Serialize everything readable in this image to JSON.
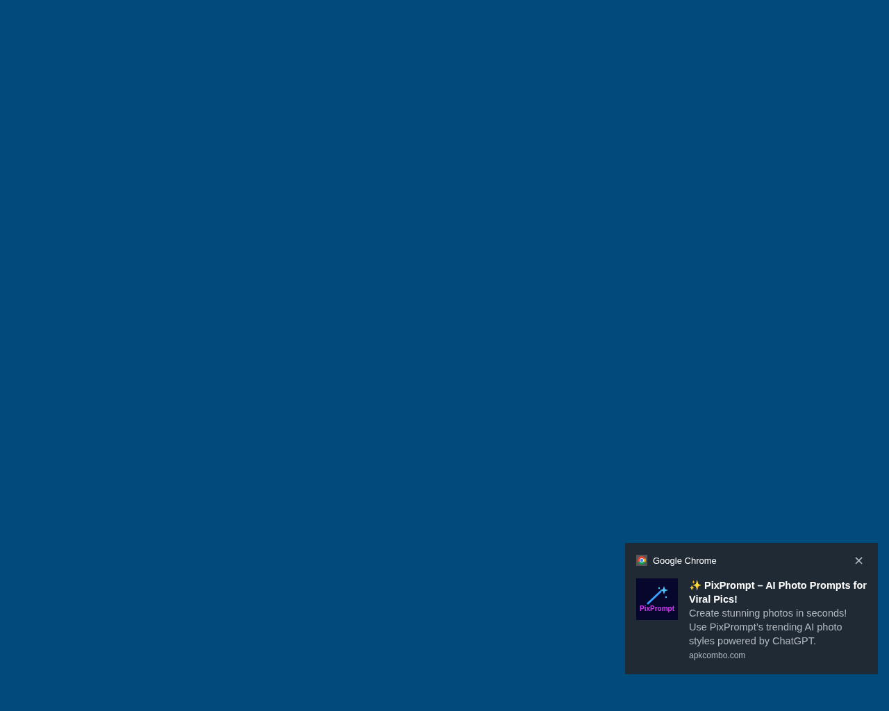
{
  "notification": {
    "app_name": "Google Chrome",
    "close": "×",
    "icon_text": "PixPrompt",
    "title": "✨ PixPrompt – AI Photo Prompts for Viral Pics!",
    "body": "Create stunning photos in seconds! Use PixPrompt’s trending AI photo styles powered by ChatGPT.",
    "source": "apkcombo.com"
  }
}
